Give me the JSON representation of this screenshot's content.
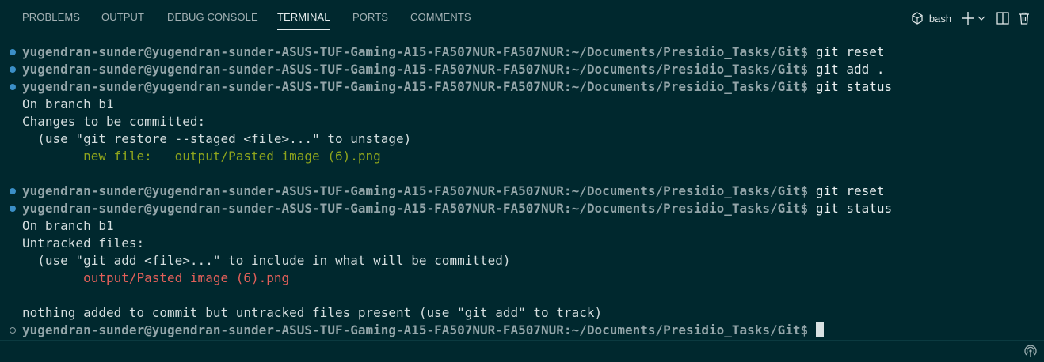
{
  "tabs": [
    {
      "label": "PROBLEMS"
    },
    {
      "label": "OUTPUT"
    },
    {
      "label": "DEBUG CONSOLE"
    },
    {
      "label": "TERMINAL",
      "active": true
    },
    {
      "label": "PORTS"
    },
    {
      "label": "COMMENTS"
    }
  ],
  "actions": {
    "shell": "bash",
    "icons": [
      "terminal-shell-icon",
      "plus-icon",
      "chevron-down-icon",
      "split-icon",
      "trash-icon"
    ]
  },
  "terminal": {
    "prompt": "yugendran-sunder@yugendran-sunder-ASUS-TUF-Gaming-A15-FA507NUR-FA507NUR:~/Documents/Presidio_Tasks/Git$",
    "lines": [
      {
        "kind": "cmd",
        "text": " git reset"
      },
      {
        "kind": "cmd",
        "text": " git add ."
      },
      {
        "kind": "cmd",
        "text": " git status"
      },
      {
        "kind": "out",
        "text": "On branch b1"
      },
      {
        "kind": "out",
        "text": "Changes to be committed:"
      },
      {
        "kind": "out",
        "text": "  (use \"git restore --staged <file>...\" to unstage)"
      },
      {
        "kind": "green",
        "text": "        new file:   output/Pasted image (6).png"
      },
      {
        "kind": "blank",
        "text": ""
      },
      {
        "kind": "cmd",
        "text": " git reset"
      },
      {
        "kind": "cmd",
        "text": " git status"
      },
      {
        "kind": "out",
        "text": "On branch b1"
      },
      {
        "kind": "out",
        "text": "Untracked files:"
      },
      {
        "kind": "out",
        "text": "  (use \"git add <file>...\" to include in what will be committed)"
      },
      {
        "kind": "red",
        "text": "        output/Pasted image (6).png"
      },
      {
        "kind": "blank",
        "text": ""
      },
      {
        "kind": "out",
        "text": "nothing added to commit but untracked files present (use \"git add\" to track)"
      },
      {
        "kind": "current",
        "text": ""
      }
    ]
  },
  "colors": {
    "background": "#00282e",
    "prompt": "#93a5a9",
    "success_dot": "#3b8fc7",
    "staged": "#8fa51c",
    "untracked": "#e4605a"
  },
  "statusbar": {
    "icon": "broadcast-icon"
  }
}
